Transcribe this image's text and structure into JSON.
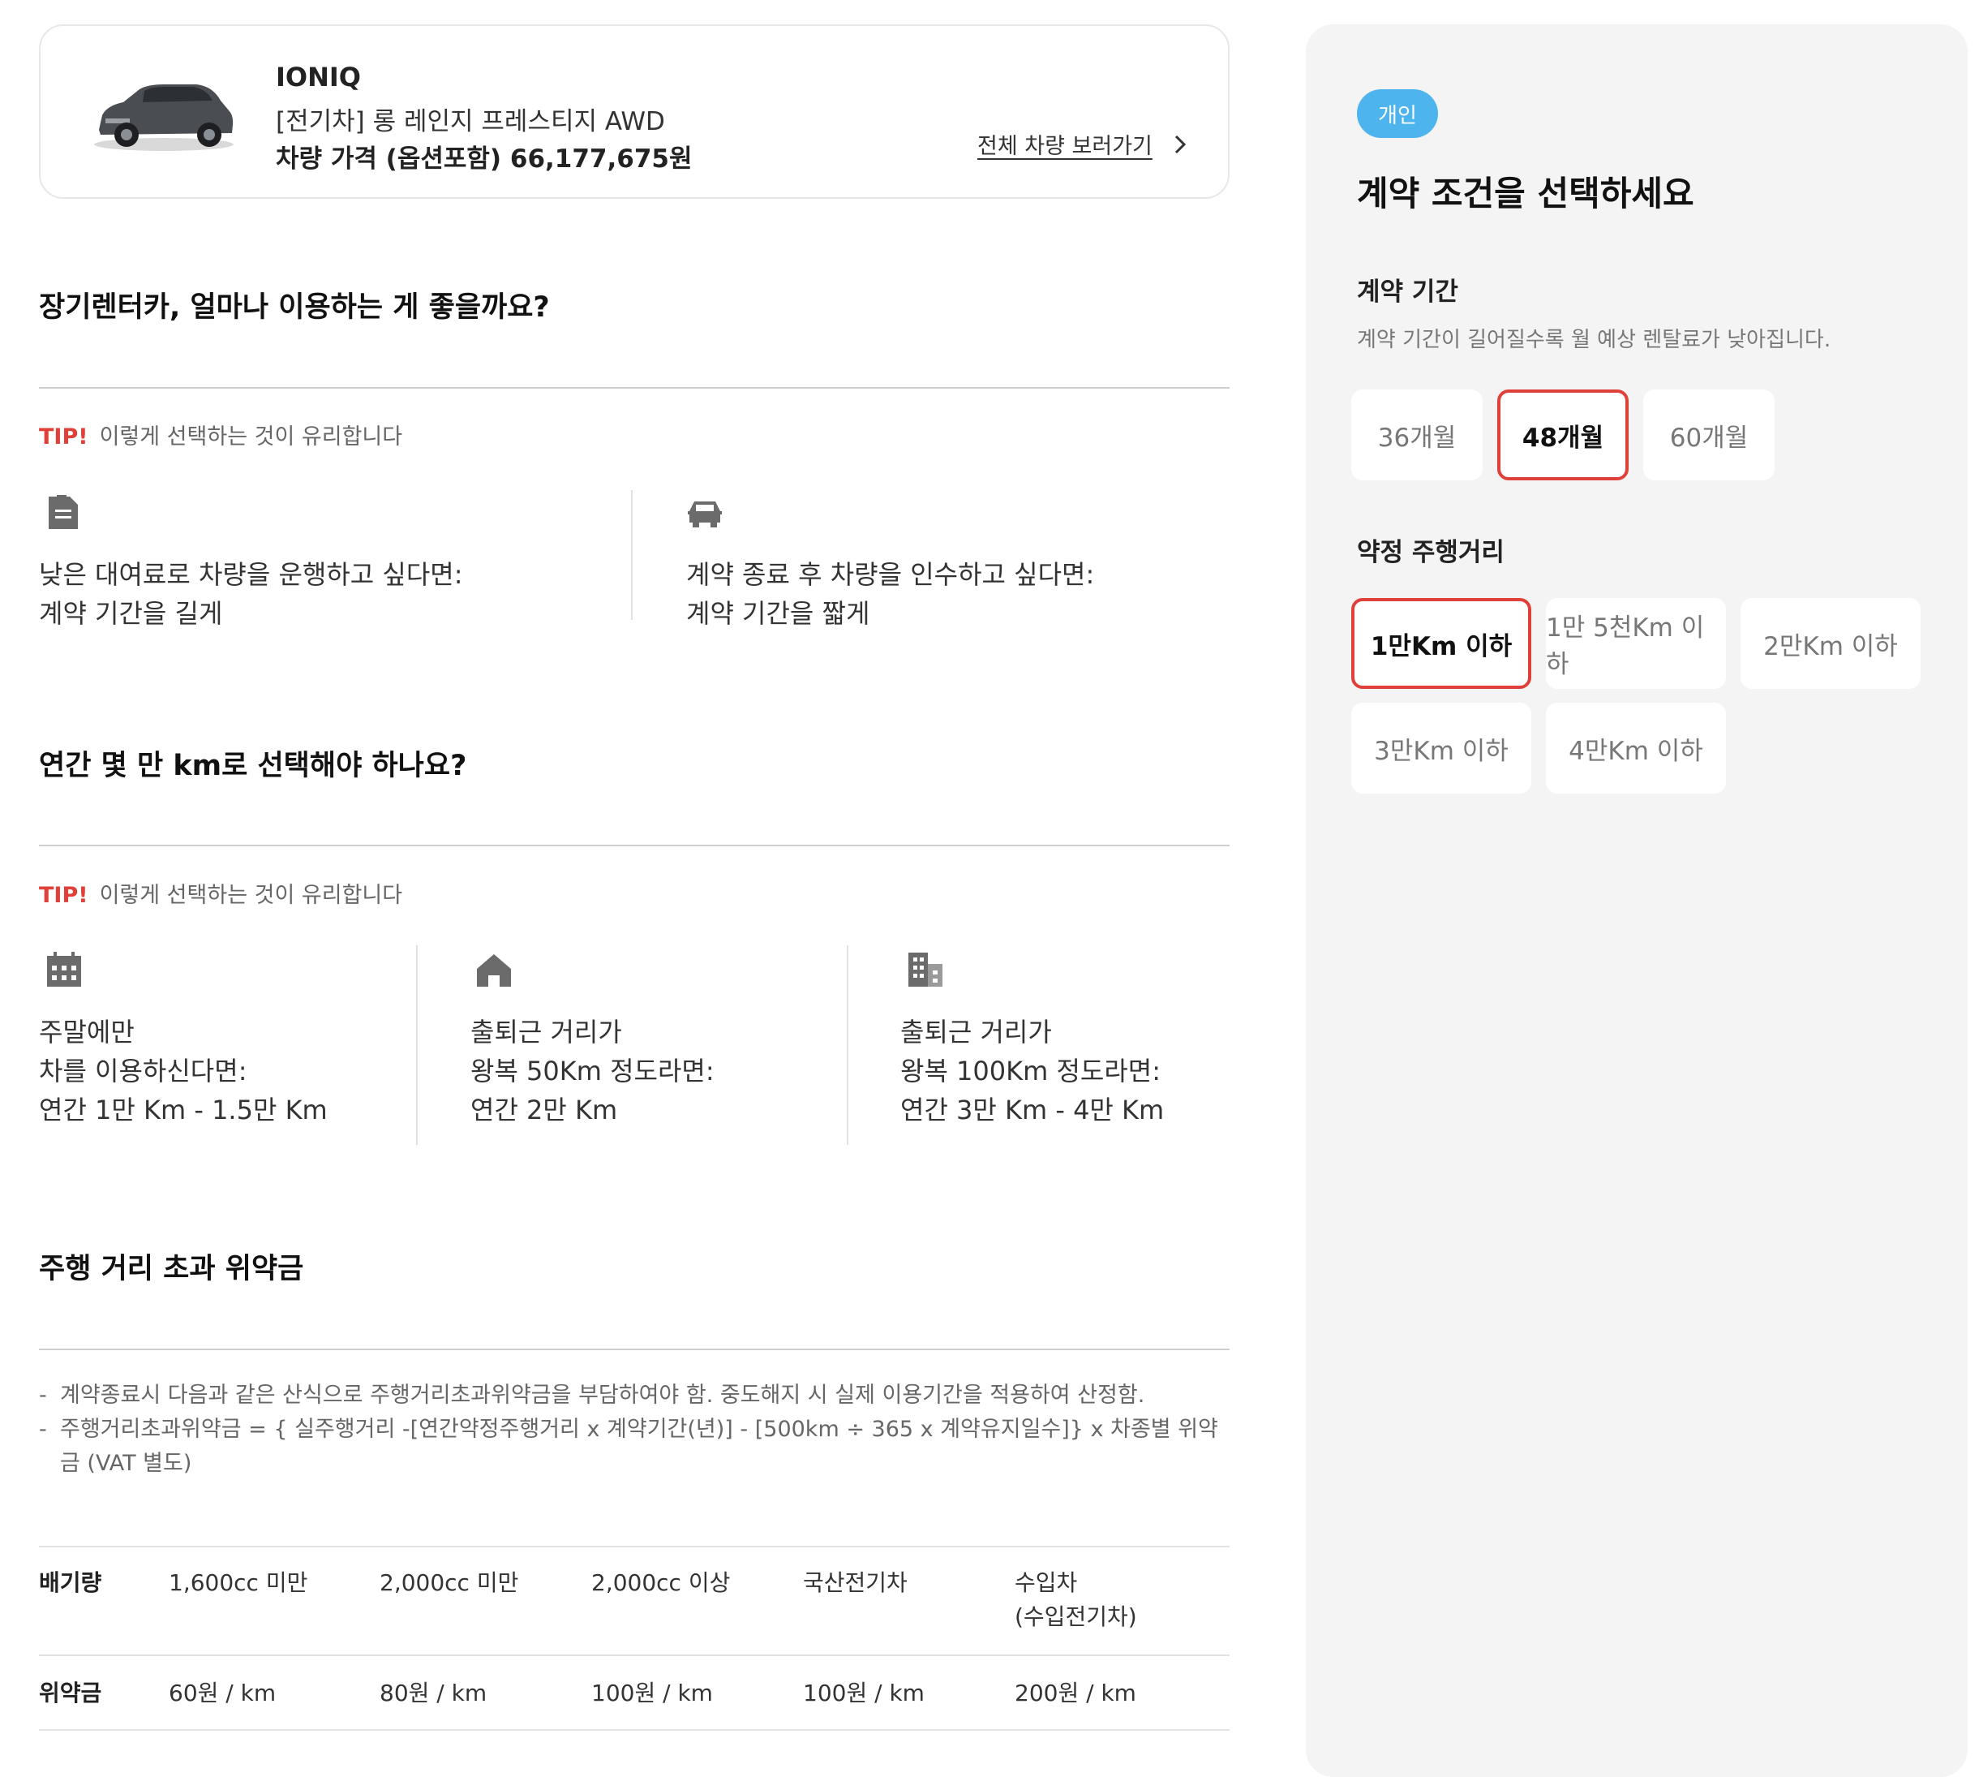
{
  "car": {
    "model": "IONIQ",
    "trim": "[전기차] 롱 레인지 프레스티지 AWD",
    "price": "차량 가격 (옵션포함) 66,177,675원",
    "view_all": "전체 차량 보러가기"
  },
  "section1": {
    "title": "장기렌터카, 얼마나 이용하는 게 좋을까요?",
    "tip_label": "TIP!",
    "tip_text": "이렇게 선택하는 것이 유리합니다",
    "items": [
      {
        "line1": "낮은 대여료로 차량을 운행하고 싶다면:",
        "line2": "계약 기간을 길게"
      },
      {
        "line1": "계약 종료 후 차량을 인수하고 싶다면:",
        "line2": "계약 기간을 짧게"
      }
    ]
  },
  "section2": {
    "title": "연간 몇 만 km로 선택해야 하나요?",
    "tip_label": "TIP!",
    "tip_text": "이렇게 선택하는 것이 유리합니다",
    "items": [
      {
        "line1": "주말에만",
        "line2": "차를 이용하신다면:",
        "line3": "연간 1만 Km - 1.5만 Km"
      },
      {
        "line1": "출퇴근 거리가",
        "line2": "왕복 50Km 정도라면:",
        "line3": "연간 2만 Km"
      },
      {
        "line1": "출퇴근 거리가",
        "line2": "왕복 100Km 정도라면:",
        "line3": "연간 3만 Km - 4만 Km"
      }
    ]
  },
  "section3": {
    "title": "주행 거리 초과 위약금",
    "notes": [
      {
        "dash": "-",
        "text": "계약종료시 다음과 같은 산식으로 주행거리초과위약금을 부담하여야 함. 중도해지 시 실제 이용기간을 적용하여 산정함."
      },
      {
        "dash": "-",
        "text": "주행거리초과위약금 = { 실주행거리 -[연간약정주행거리 x 계약기간(년)] - [500km ÷ 365 x 계약유지일수]} x 차종별 위약",
        "text2": "금 (VAT 별도)"
      }
    ],
    "table": {
      "row1_label": "배기량",
      "row1": [
        "1,600cc 미만",
        "2,000cc 미만",
        "2,000cc 이상",
        "국산전기차",
        "수입차"
      ],
      "row1_extra": "(수입전기차)",
      "row2_label": "위약금",
      "row2": [
        "60원 / km",
        "80원 / km",
        "100원 / km",
        "100원 / km",
        "200원 / km"
      ]
    }
  },
  "panel": {
    "badge": "개인",
    "title": "계약 조건을 선택하세요",
    "period_title": "계약 기간",
    "period_desc": "계약 기간이 길어질수록 월 예상 렌탈료가 낮아집니다.",
    "periods": [
      "36개월",
      "48개월",
      "60개월"
    ],
    "selected_period": "48개월",
    "mileage_title": "약정 주행거리",
    "mileages": [
      "1만Km 이하",
      "1만 5천Km 이하",
      "2만Km 이하",
      "3만Km 이하",
      "4만Km 이하"
    ],
    "selected_mileage": "1만Km 이하"
  },
  "colors": {
    "accent_red": "#e0403a",
    "badge_blue": "#4db4ee",
    "panel_bg": "#f4f4f5"
  }
}
